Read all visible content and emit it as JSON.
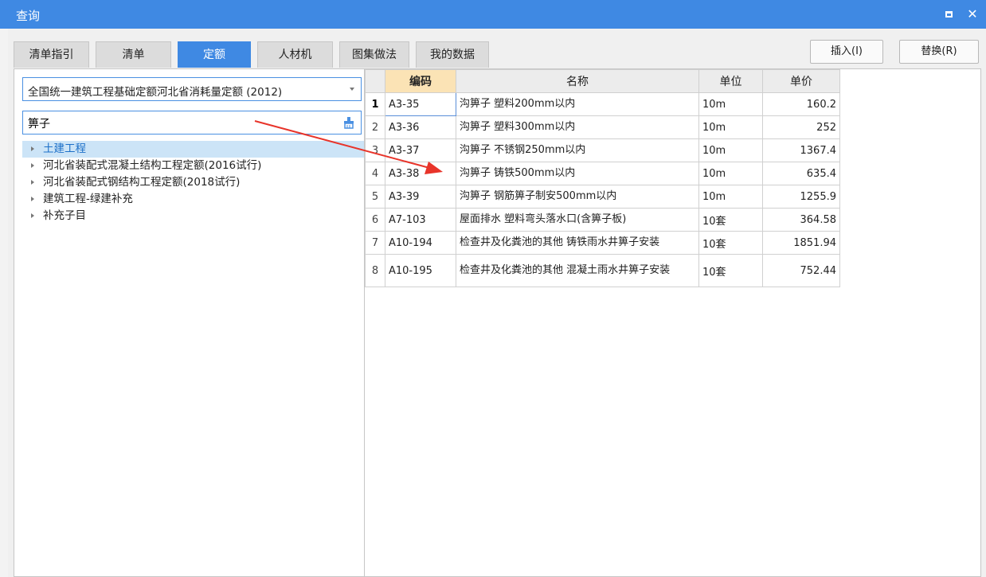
{
  "window": {
    "title": "查询"
  },
  "tabs": [
    {
      "label": "清单指引"
    },
    {
      "label": "清单"
    },
    {
      "label": "定额",
      "active": true
    },
    {
      "label": "人材机"
    },
    {
      "label": "图集做法"
    },
    {
      "label": "我的数据"
    }
  ],
  "actions": {
    "insert_label": "插入(I)",
    "replace_label": "替换(R)"
  },
  "library": {
    "selected": "全国统一建筑工程基础定额河北省消耗量定额 (2012)"
  },
  "search": {
    "value": "箅子"
  },
  "tree": [
    {
      "label": "土建工程",
      "selected": true
    },
    {
      "label": "河北省装配式混凝土结构工程定额(2016试行)"
    },
    {
      "label": "河北省装配式钢结构工程定额(2018试行)"
    },
    {
      "label": "建筑工程-绿建补充"
    },
    {
      "label": "补充子目"
    }
  ],
  "table": {
    "headers": {
      "code": "编码",
      "name": "名称",
      "unit": "单位",
      "price": "单价"
    },
    "rows": [
      {
        "no": "1",
        "code": "A3-35",
        "name": "沟箅子 塑料200mm以内",
        "unit": "10m",
        "price": "160.2"
      },
      {
        "no": "2",
        "code": "A3-36",
        "name": "沟箅子 塑料300mm以内",
        "unit": "10m",
        "price": "252"
      },
      {
        "no": "3",
        "code": "A3-37",
        "name": "沟箅子 不锈钢250mm以内",
        "unit": "10m",
        "price": "1367.4"
      },
      {
        "no": "4",
        "code": "A3-38",
        "name": "沟箅子 铸铁500mm以内",
        "unit": "10m",
        "price": "635.4"
      },
      {
        "no": "5",
        "code": "A3-39",
        "name": "沟箅子 钢筋箅子制安500mm以内",
        "unit": "10m",
        "price": "1255.9"
      },
      {
        "no": "6",
        "code": "A7-103",
        "name": "屋面排水 塑料弯头落水口(含箅子板)",
        "unit": "10套",
        "price": "364.58"
      },
      {
        "no": "7",
        "code": "A10-194",
        "name": "检查井及化粪池的其他 铸铁雨水井箅子安装",
        "unit": "10套",
        "price": "1851.94"
      },
      {
        "no": "8",
        "code": "A10-195",
        "name": "检查井及化粪池的其他 混凝土雨水井箅子安装",
        "unit": "10套",
        "price": "752.44"
      }
    ]
  },
  "colors": {
    "accent": "#3f89e3",
    "annotation": "#e8342a",
    "header_highlight": "#fbe3b5",
    "selected_row": "#cce4f7"
  }
}
